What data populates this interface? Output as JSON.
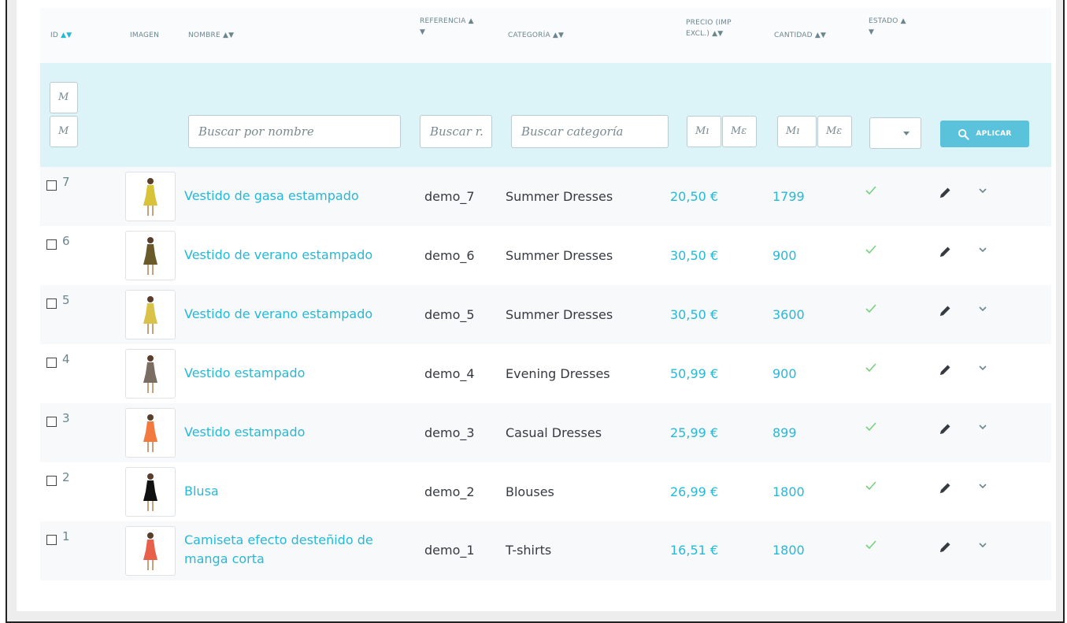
{
  "headers": {
    "id": "ID",
    "image": "IMAGEN",
    "name": "NOMBRE",
    "reference_line1": "REFERENCIA",
    "category": "CATEGORÍA",
    "price_line1": "PRECIO (IMP",
    "price_line2": "EXCL.)",
    "quantity": "CANTIDAD",
    "status_line1": "ESTADO",
    "sort_arrows": "▲▼",
    "arrow_up": "▲",
    "arrow_down": "▼"
  },
  "filters": {
    "id_min_placeholder": "M",
    "id_max_placeholder": "M",
    "name_placeholder": "Buscar por nombre",
    "reference_placeholder": "Buscar r.",
    "category_placeholder": "Buscar categoría",
    "price_min_placeholder": "Mı",
    "price_max_placeholder": "Mε",
    "qty_min_placeholder": "Mı",
    "qty_max_placeholder": "Mε",
    "status_value": "",
    "apply_label": "APLICAR"
  },
  "products": [
    {
      "id": "7",
      "name": "Vestido de gasa estampado",
      "reference": "demo_7",
      "category": "Summer Dresses",
      "price": "20,50 €",
      "quantity": "1799",
      "active": true,
      "image_color": "#d8c23a"
    },
    {
      "id": "6",
      "name": "Vestido de verano estampado",
      "reference": "demo_6",
      "category": "Summer Dresses",
      "price": "30,50 €",
      "quantity": "900",
      "active": true,
      "image_color": "#6a5a2a"
    },
    {
      "id": "5",
      "name": "Vestido de verano estampado",
      "reference": "demo_5",
      "category": "Summer Dresses",
      "price": "30,50 €",
      "quantity": "3600",
      "active": true,
      "image_color": "#d9c24a"
    },
    {
      "id": "4",
      "name": "Vestido estampado",
      "reference": "demo_4",
      "category": "Evening Dresses",
      "price": "50,99 €",
      "quantity": "900",
      "active": true,
      "image_color": "#7a6e62"
    },
    {
      "id": "3",
      "name": "Vestido estampado",
      "reference": "demo_3",
      "category": "Casual Dresses",
      "price": "25,99 €",
      "quantity": "899",
      "active": true,
      "image_color": "#f27a3f"
    },
    {
      "id": "2",
      "name": "Blusa",
      "reference": "demo_2",
      "category": "Blouses",
      "price": "26,99 €",
      "quantity": "1800",
      "active": true,
      "image_color": "#111111"
    },
    {
      "id": "1",
      "name": "Camiseta efecto desteñido de manga corta",
      "reference": "demo_1",
      "category": "T-shirts",
      "price": "16,51 €",
      "quantity": "1800",
      "active": true,
      "image_color": "#e8604a"
    }
  ],
  "icons": {
    "status": "check-icon",
    "edit": "pencil-icon",
    "more": "chevron-down-icon",
    "apply": "search-icon",
    "select": "caret-down-icon"
  },
  "colors": {
    "accent": "#25b9d7",
    "filter_bg": "#dcf3f7",
    "apply_bg": "#5bc2dc",
    "check": "#78d07d"
  }
}
